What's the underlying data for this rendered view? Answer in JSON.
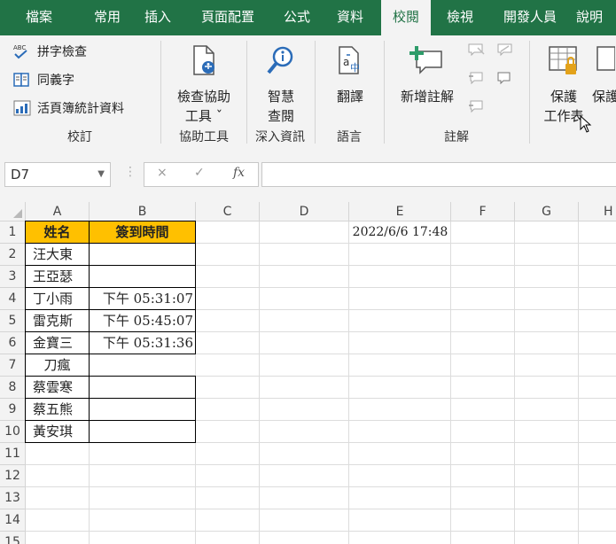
{
  "tabs": [
    "檔案",
    "常用",
    "插入",
    "頁面配置",
    "公式",
    "資料",
    "校閱",
    "檢視",
    "開發人員",
    "說明"
  ],
  "active_tab": "校閱",
  "ribbon": {
    "proofing": {
      "spelling": "拼字檢查",
      "thesaurus": "同義字",
      "stats": "活頁簿統計資料",
      "label": "校訂"
    },
    "accessibility": {
      "check_line1": "檢查協助",
      "check_line2": "工具 ˇ",
      "label": "協助工具"
    },
    "insights": {
      "smart_line1": "智慧",
      "smart_line2": "查閱",
      "label": "深入資訊"
    },
    "language": {
      "translate": "翻譯",
      "label": "語言"
    },
    "comments": {
      "new": "新增註解",
      "label": "註解"
    },
    "protect": {
      "sheet_line1": "保護",
      "sheet_line2": "工作表",
      "workbook": "保護"
    }
  },
  "formula_bar": {
    "name_box": "D7",
    "cancel": "×",
    "enter": "✓",
    "fx": "fx",
    "value": ""
  },
  "columns": [
    "A",
    "B",
    "C",
    "D",
    "E",
    "F",
    "G",
    "H"
  ],
  "rows": [
    "1",
    "2",
    "3",
    "4",
    "5",
    "6",
    "7",
    "8",
    "9",
    "10",
    "11",
    "12",
    "13",
    "14",
    "15"
  ],
  "sheet": {
    "header_name": "姓名",
    "header_time": "簽到時間",
    "names": [
      "汪大東",
      "王亞瑟",
      "丁小雨",
      "雷克斯",
      "金寶三",
      "刀瘋",
      "蔡雲寒",
      "蔡五熊",
      "黃安琪"
    ],
    "times": [
      "",
      "",
      "下午 05:31:07",
      "下午 05:45:07",
      "下午 05:31:36",
      "",
      "",
      "",
      ""
    ],
    "e1": "2022/6/6 17:48"
  },
  "colors": {
    "accent": "#217346",
    "header_fill": "#ffc000"
  }
}
